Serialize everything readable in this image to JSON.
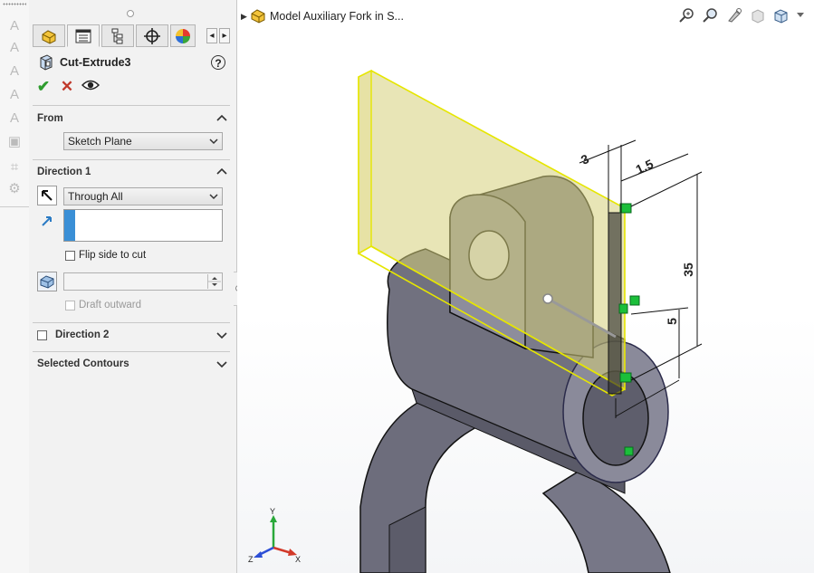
{
  "feature": {
    "name": "Cut-Extrude3",
    "help_label": "?",
    "actions": {
      "ok": "✔",
      "cancel": "✕",
      "preview": "👁"
    }
  },
  "sections": {
    "from": {
      "title": "From",
      "combo_value": "Sketch Plane"
    },
    "direction1": {
      "title": "Direction 1",
      "end_condition": "Through All",
      "flip_side_label": "Flip side to cut",
      "draft_label": "Draft outward",
      "draft_value": ""
    },
    "direction2": {
      "title": "Direction 2"
    },
    "selected_contours": {
      "title": "Selected Contours"
    }
  },
  "tabs": [
    "feature-manager-icon",
    "property-manager-icon",
    "configuration-manager-icon",
    "dimxpert-icon",
    "display-manager-icon"
  ],
  "graphics": {
    "tree_label": "Model Auxiliary Fork in S...",
    "dimensions": {
      "d1": "3",
      "d2": "1.5",
      "d3": "35",
      "d4": "5"
    },
    "triad": {
      "x": "X",
      "y": "Y",
      "z": "Z"
    }
  },
  "colors": {
    "accent_blue": "#3a8fd6",
    "ok_green": "#2e9c2e",
    "cancel_red": "#c0392b",
    "model_gray": "#6b6b7a",
    "preview_yellow": "#e6e600",
    "handle_green": "#1bbf3a"
  }
}
